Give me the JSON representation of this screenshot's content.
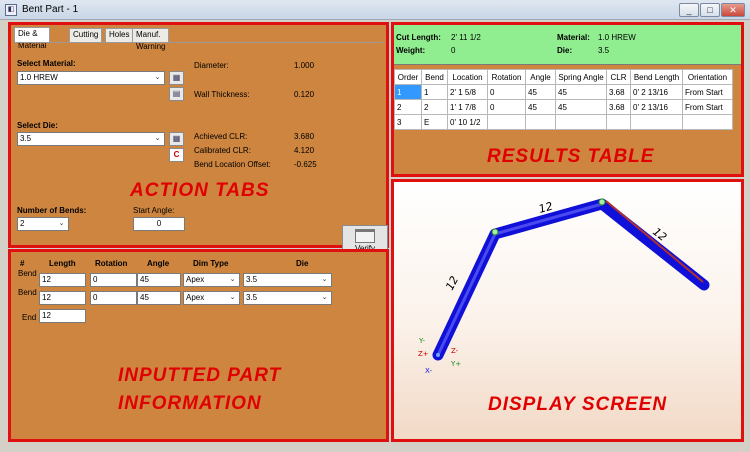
{
  "window": {
    "title": "Bent Part - 1",
    "min_label": "_",
    "max_label": "□",
    "close_label": "✕"
  },
  "tabs": {
    "items": [
      {
        "label": "Die & Material"
      },
      {
        "label": "Cutting"
      },
      {
        "label": "Holes"
      },
      {
        "label": "Manuf. Warning"
      }
    ],
    "material": {
      "label": "Select Material:",
      "value": "1.0 HREW",
      "diameter_label": "Diameter:",
      "diameter_value": "1.000",
      "wall_label": "Wall Thickness:",
      "wall_value": "0.120"
    },
    "die": {
      "label": "Select Die:",
      "value": "3.5",
      "achieved_clr_label": "Achieved CLR:",
      "achieved_clr_value": "3.680",
      "calibrated_clr_label": "Calibrated CLR:",
      "calibrated_clr_value": "4.120",
      "offset_label": "Bend Location Offset:",
      "offset_value": "-0.625"
    },
    "bends": {
      "label": "Number of Bends:",
      "value": "2",
      "start_angle_label": "Start Angle:",
      "start_angle_value": "0",
      "verify_label": "Verify"
    },
    "overlay": "ACTION TABS"
  },
  "results": {
    "cut_length_label": "Cut Length:",
    "cut_length_value": "2' 11 1/2",
    "weight_label": "Weight:",
    "weight_value": "0",
    "material_label": "Material:",
    "material_value": "1.0 HREW",
    "die_label": "Die:",
    "die_value": "3.5",
    "columns": [
      "Order",
      "Bend",
      "Location",
      "Rotation",
      "Angle",
      "Spring Angle",
      "CLR",
      "Bend Length",
      "Orientation"
    ],
    "rows": [
      [
        "1",
        "1",
        "2' 1 5/8",
        "0",
        "45",
        "45",
        "3.68",
        "0' 2 13/16",
        "From Start"
      ],
      [
        "2",
        "2",
        "1' 1 7/8",
        "0",
        "45",
        "45",
        "3.68",
        "0' 2 13/16",
        "From Start"
      ],
      [
        "3",
        "E",
        "0' 10 1/2",
        "",
        "",
        "",
        "",
        "",
        ""
      ]
    ],
    "overlay": "RESULTS TABLE"
  },
  "inputs": {
    "headers": {
      "num": "#",
      "length": "Length",
      "rotation": "Rotation",
      "angle": "Angle",
      "dim_type": "Dim Type",
      "die": "Die"
    },
    "bend_label": "Bend",
    "end_label": "End",
    "rows": [
      {
        "length": "12",
        "rotation": "0",
        "angle": "45",
        "dim_type": "Apex",
        "die": "3.5"
      },
      {
        "length": "12",
        "rotation": "0",
        "angle": "45",
        "dim_type": "Apex",
        "die": "3.5"
      }
    ],
    "end_length": "12",
    "overlay_line1": "INPUTTED PART",
    "overlay_line2": "INFORMATION"
  },
  "display": {
    "segment_labels": [
      "12",
      "12",
      "12"
    ],
    "axes": {
      "y_minus": "Y-",
      "z_plus": "Z+",
      "z_minus": "Z-",
      "x_minus": "X-",
      "y_plus": "Y+"
    },
    "overlay": "DISPLAY SCREEN",
    "tube_color": "#1010d8",
    "selected_color": "#b03030"
  }
}
